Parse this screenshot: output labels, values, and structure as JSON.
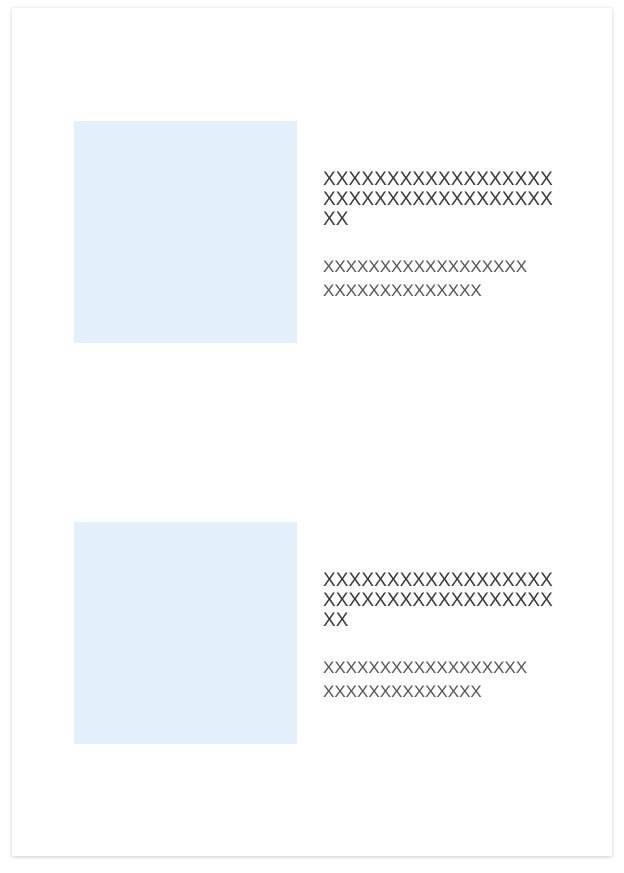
{
  "cards": [
    {
      "title": "XXXXXXXXXXXXXXXXXXXXXXXXXXXXXXXXXXXXXX",
      "text_line_1": "XXXXXXXXXXXXXXXXXX",
      "text_line_2": "XXXXXXXXXXXXXX"
    },
    {
      "title": "XXXXXXXXXXXXXXXXXXXXXXXXXXXXXXXXXXXXXX",
      "text_line_1": "XXXXXXXXXXXXXXXXXX",
      "text_line_2": "XXXXXXXXXXXXXX"
    }
  ],
  "colors": {
    "image_placeholder": "#e3f0fb",
    "title_text": "#3a3a3a",
    "body_text": "#555555"
  }
}
